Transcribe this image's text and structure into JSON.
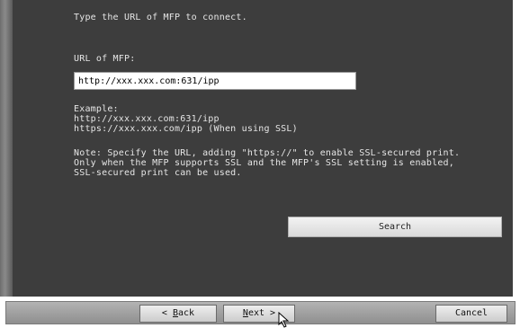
{
  "instructions": {
    "heading": "Type the URL of MFP to connect.",
    "url_label": "URL of MFP:",
    "example_title": "Example:",
    "example_1": "http://xxx.xxx.com:631/ipp",
    "example_2": "https://xxx.xxx.com/ipp (When using SSL)",
    "note_1": "Note: Specify the URL, adding \"https://\" to enable SSL-secured print.",
    "note_2": "Only when the MFP supports SSL and the MFP's SSL setting is enabled,",
    "note_3": "SSL-secured print can be used."
  },
  "url_field": {
    "value": "http://xxx.xxx.com:631/ipp"
  },
  "buttons": {
    "search": "Search",
    "back_prefix": "< ",
    "back_key": "B",
    "back_rest": "ack",
    "next_key": "N",
    "next_rest": "ext >",
    "cancel": "Cancel"
  },
  "icons": {
    "cursor": "mouse-pointer-icon"
  }
}
